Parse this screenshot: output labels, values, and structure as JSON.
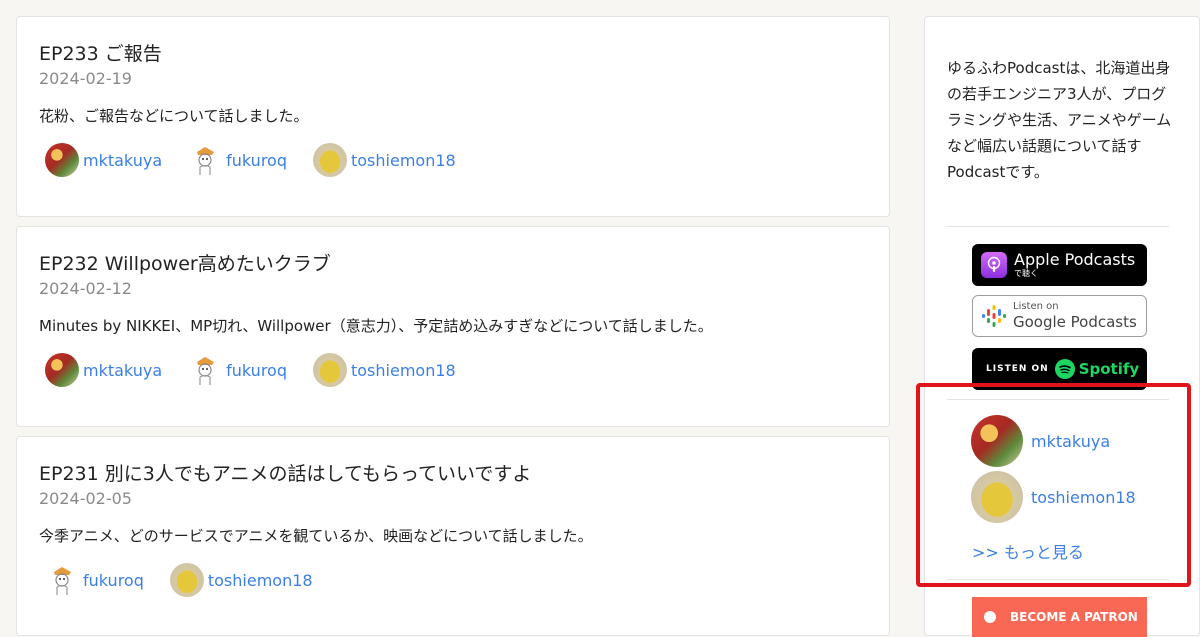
{
  "episodes": [
    {
      "title": "EP233 ご報告",
      "date": "2024-02-19",
      "description": "花粉、ご報告などについて話しました。",
      "members": [
        "mktakuya",
        "fukuroq",
        "toshiemon18"
      ]
    },
    {
      "title": "EP232 Willpower高めたいクラブ",
      "date": "2024-02-12",
      "description": "Minutes by NIKKEI、MP切れ、Willpower（意志力）、予定詰め込みすぎなどについて話しました。",
      "members": [
        "mktakuya",
        "fukuroq",
        "toshiemon18"
      ]
    },
    {
      "title": "EP231 別に3人でもアニメの話はしてもらっていいですよ",
      "date": "2024-02-05",
      "description": "今季アニメ、どのサービスでアニメを観ているか、映画などについて話しました。",
      "members": [
        "fukuroq",
        "toshiemon18"
      ]
    }
  ],
  "sidebar": {
    "about": "ゆるふわPodcastは、北海道出身の若手エンジニア3人が、プログラミングや生活、アニメやゲームなど幅広い話題について話すPodcastです。",
    "badges": {
      "apple_main": "Apple Podcasts",
      "apple_sub": "で聴く",
      "google_sub": "Listen on",
      "google_main": "Google Podcasts",
      "spotify_listen": "LISTEN ON",
      "spotify_word": "Spotify"
    },
    "members": [
      "mktakuya",
      "toshiemon18"
    ],
    "more_link": ">> もっと見る",
    "patron_label": "BECOME A PATRON"
  },
  "colors": {
    "link": "#3b7fe6",
    "highlight": "#e0141b",
    "patron": "#f96854",
    "spotify": "#1ed760"
  }
}
